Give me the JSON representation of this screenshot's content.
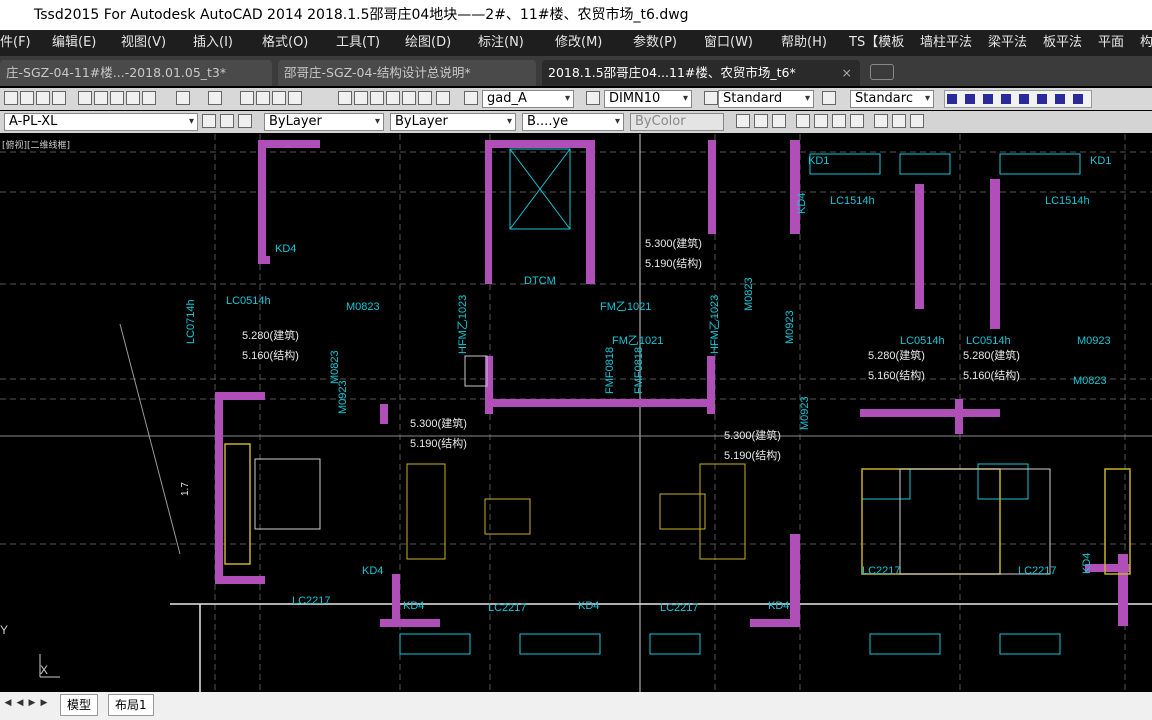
{
  "window": {
    "title": "Tssd2015 For Autodesk AutoCAD 2014    2018.1.5邵哥庄04地块——2#、11#楼、农贸市场_t6.dwg"
  },
  "menu": {
    "items": [
      "件(F)",
      "编辑(E)",
      "视图(V)",
      "插入(I)",
      "格式(O)",
      "工具(T)",
      "绘图(D)",
      "标注(N)",
      "修改(M)",
      "参数(P)",
      "窗口(W)",
      "帮助(H)",
      "TS【模板",
      "墙柱平法",
      "梁平法",
      "板平法",
      "平面",
      "构"
    ]
  },
  "tabs": [
    {
      "label": "庄-SGZ-04-11#楼...-2018.01.05_t3*"
    },
    {
      "label": "邵哥庄-SGZ-04-结构设计总说明*"
    },
    {
      "label": "2018.1.5邵哥庄04...11#楼、农贸市场_t6*",
      "close": "×"
    }
  ],
  "toolbar1": {
    "text_style": "gad_A",
    "dim_style": "DIMN10",
    "table_style": "Standard",
    "multileader_style": "Standarc"
  },
  "toolbar2": {
    "layer": "A-PL-XL",
    "color": "ByLayer",
    "linetype": "ByLayer",
    "lineweight": "B....ye",
    "plotstyle": "ByColor"
  },
  "canvas": {
    "view_label": "[俯视][二维线框]",
    "labels": [
      "KD4",
      "KD4",
      "KD4",
      "KD4",
      "KD4",
      "KD4",
      "KD4",
      "KD1",
      "KD1",
      "M0823",
      "M0823",
      "M0823",
      "M0823",
      "M0923",
      "M0923",
      "M0923",
      "M0923",
      "DTCM",
      "FM乙1021",
      "FM乙1021",
      "HFM乙1023",
      "HFM乙1023",
      "LC0714h",
      "LC0514h",
      "LC1514h",
      "LC1514h",
      "LC0514h",
      "LC0514h",
      "LC2217",
      "LC2217",
      "LC2217",
      "LC2217",
      "LC2217",
      "FMF0818",
      "FMF0818"
    ],
    "elevations": [
      "5.300(建筑)",
      "5.190(结构)",
      "5.280(建筑)",
      "5.160(结构)",
      "5.300(建筑)",
      "5.190(结构)",
      "5.300(建筑)",
      "5.190(结构)",
      "5.280(建筑)",
      "5.160(结构)",
      "5.280(建筑)",
      "5.160(结构)"
    ],
    "dimension_text": "1.7",
    "ucs": {
      "x": "X",
      "y": "Y"
    }
  },
  "layout_tabs": [
    "模型",
    "布局1"
  ],
  "colors": {
    "wall": "#b14fb8",
    "window": "#12c7d8",
    "furniture": "#c8b026",
    "grid": "#b0b0b0"
  }
}
